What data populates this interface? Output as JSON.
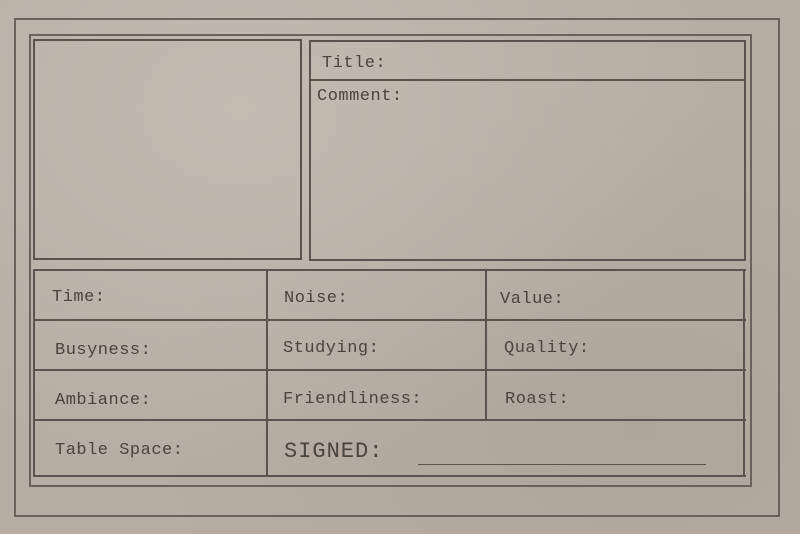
{
  "card": {
    "title_label": "Title:",
    "comment_label": "Comment:",
    "fields": {
      "time": "Time:",
      "noise": "Noise:",
      "value": "Value:",
      "busyness": "Busyness:",
      "studying": "Studying:",
      "quality": "Quality:",
      "ambiance": "Ambiance:",
      "friendliness": "Friendliness:",
      "roast": "Roast:",
      "table_space": "Table Space:"
    },
    "signed_label": "SIGNED:"
  }
}
